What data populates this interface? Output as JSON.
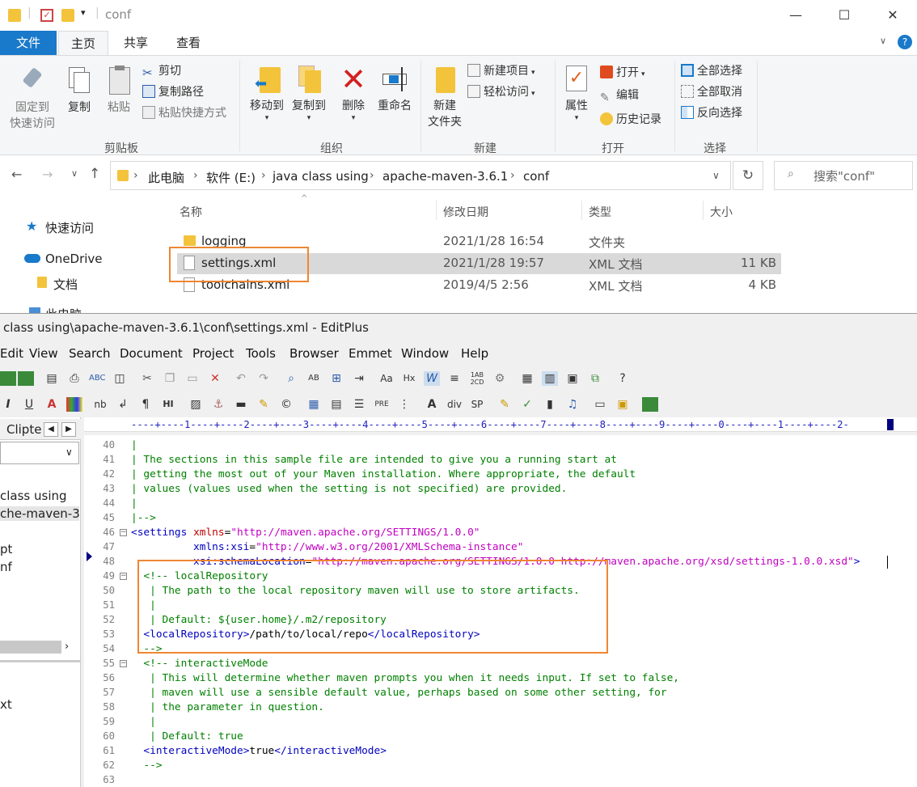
{
  "explorer": {
    "title": "conf",
    "window_controls": {
      "minimize": "—",
      "maximize": "☐",
      "close": "✕"
    },
    "tabs": [
      "文件",
      "主页",
      "共享",
      "查看"
    ],
    "ribbon": {
      "clipboard": {
        "pin": "固定到\n快速访问",
        "pin1": "固定到",
        "pin2": "快速访问",
        "copy": "复制",
        "paste": "粘贴",
        "cut": "剪切",
        "copy_path": "复制路径",
        "paste_shortcut": "粘贴快捷方式",
        "label": "剪贴板"
      },
      "organize": {
        "move_to": "移动到",
        "copy_to": "复制到",
        "delete": "删除",
        "rename": "重命名",
        "label": "组织"
      },
      "new": {
        "new_folder1": "新建",
        "new_folder2": "文件夹",
        "new_item": "新建项目",
        "easy_access": "轻松访问",
        "label": "新建"
      },
      "open": {
        "properties": "属性",
        "open": "打开",
        "edit": "编辑",
        "history": "历史记录",
        "label": "打开"
      },
      "select": {
        "select_all": "全部选择",
        "select_none": "全部取消",
        "invert": "反向选择",
        "label": "选择"
      }
    },
    "breadcrumb": [
      "此电脑",
      "软件 (E:)",
      "java class using",
      "apache-maven-3.6.1",
      "conf"
    ],
    "search_placeholder": "搜索\"conf\"",
    "nav": {
      "quick_access": "快速访问",
      "onedrive": "OneDrive",
      "documents": "文档",
      "this_pc": "此电脑"
    },
    "columns": {
      "name": "名称",
      "modified": "修改日期",
      "type": "类型",
      "size": "大小"
    },
    "files": [
      {
        "name": "logging",
        "modified": "2021/1/28 16:54",
        "type": "文件夹",
        "size": ""
      },
      {
        "name": "settings.xml",
        "modified": "2021/1/28 19:57",
        "type": "XML 文档",
        "size": "11 KB"
      },
      {
        "name": "toolchains.xml",
        "modified": "2019/4/5 2:56",
        "type": "XML 文档",
        "size": "4 KB"
      }
    ]
  },
  "editplus": {
    "title": "class using\\apache-maven-3.6.1\\conf\\settings.xml - EditPlus",
    "menu": [
      "Edit",
      "View",
      "Search",
      "Document",
      "Project",
      "Tools",
      "Browser",
      "Emmet",
      "Window",
      "Help"
    ],
    "left_tab": "Clipte",
    "left_tree": [
      "class using",
      "che-maven-3.",
      "pt",
      "nf",
      "xt"
    ],
    "ruler": "----+----1----+----2----+----3----+----4----+----5----+----6----+----7----+----8----+----9----+----0----+----1----+----2-",
    "lines": [
      {
        "n": "40",
        "t": "|"
      },
      {
        "n": "41",
        "t": "| The sections in this sample file are intended to give you a running start at"
      },
      {
        "n": "42",
        "t": "| getting the most out of your Maven installation. Where appropriate, the default"
      },
      {
        "n": "43",
        "t": "| values (values used when the setting is not specified) are provided."
      },
      {
        "n": "44",
        "t": "|"
      },
      {
        "n": "45",
        "t": "|-->"
      },
      {
        "n": "46",
        "t": ""
      },
      {
        "n": "47",
        "t": ""
      },
      {
        "n": "48",
        "t": ""
      },
      {
        "n": "49",
        "t": "  <!-- localRepository"
      },
      {
        "n": "50",
        "t": "   | The path to the local repository maven will use to store artifacts."
      },
      {
        "n": "51",
        "t": "   |"
      },
      {
        "n": "52",
        "t": "   | Default: ${user.home}/.m2/repository"
      },
      {
        "n": "53",
        "t": "  <localRepository>/path/to/local/repo</localRepository>"
      },
      {
        "n": "54",
        "t": "  -->"
      },
      {
        "n": "55",
        "t": "  <!-- interactiveMode"
      },
      {
        "n": "56",
        "t": "   | This will determine whether maven prompts you when it needs input. If set to false,"
      },
      {
        "n": "57",
        "t": "   | maven will use a sensible default value, perhaps based on some other setting, for"
      },
      {
        "n": "58",
        "t": "   | the parameter in question."
      },
      {
        "n": "59",
        "t": "   |"
      },
      {
        "n": "60",
        "t": "   | Default: true"
      },
      {
        "n": "61",
        "t": "  <interactiveMode>true</interactiveMode>"
      },
      {
        "n": "62",
        "t": "  -->"
      },
      {
        "n": "63",
        "t": ""
      }
    ],
    "settings_line": {
      "tag": "<settings",
      "a1": "xmlns",
      "v1": "\"http://maven.apache.org/SETTINGS/1.0.0\"",
      "a2": "xmlns:xsi",
      "v2": "\"http://www.w3.org/2001/XMLSchema-instance\"",
      "a3": "xsi:schemaLocation",
      "v3": "\"http://maven.apache.org/SETTINGS/1.0.0 http://maven.apache.org/xsd/settings-1.0.0.xsd\"",
      "close": ">"
    }
  },
  "colors": {
    "highlight": "#ef8633",
    "selected_row": "#d9d9d9",
    "accent": "#1979ca"
  }
}
